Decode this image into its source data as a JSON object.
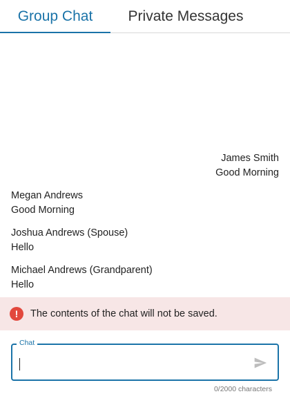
{
  "tabs": [
    {
      "label": "Group Chat",
      "active": true
    },
    {
      "label": "Private Messages",
      "active": false
    }
  ],
  "messages": [
    {
      "sender": "James Smith",
      "text": "Good Morning",
      "align": "right"
    },
    {
      "sender": "Megan Andrews",
      "text": "Good Morning",
      "align": "left"
    },
    {
      "sender": "Joshua Andrews (Spouse)",
      "text": "Hello",
      "align": "left"
    },
    {
      "sender": "Michael Andrews (Grandparent)",
      "text": "Hello",
      "align": "left"
    }
  ],
  "warning": {
    "icon": "error-icon",
    "text": "The contents of the chat will not be saved."
  },
  "chat": {
    "label": "Chat",
    "value": "",
    "counter": "0/2000 characters"
  },
  "colors": {
    "accent": "#1a73a8",
    "warning_bg": "#f7e6e6",
    "error": "#e2483d"
  }
}
